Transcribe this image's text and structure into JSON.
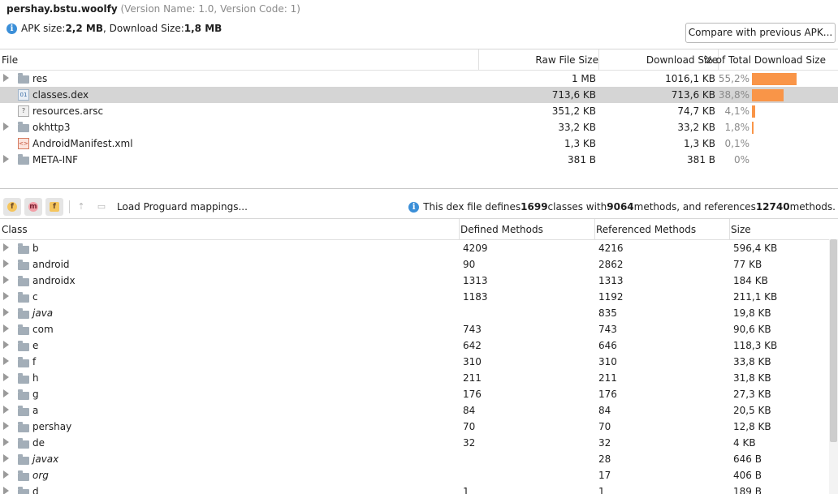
{
  "header": {
    "package": "pershay.bstu.woolfy",
    "version_text": "(Version Name: 1.0, Version Code: 1)",
    "apk_size_label": "APK size: ",
    "apk_size_value": "2,2 MB",
    "download_size_label": ", Download Size: ",
    "download_size_value": "1,8 MB",
    "info_glyph": "i",
    "compare_button": "Compare with previous APK..."
  },
  "file_table": {
    "columns": [
      "File",
      "Raw File Size",
      "Download Size",
      "% of Total Download Size"
    ],
    "rows": [
      {
        "name": "res",
        "icon": "folder-icon",
        "expandable": true,
        "raw": "1 MB",
        "download": "1016,1 KB",
        "pct": "55,2%",
        "pct_value": 55.2,
        "selected": false
      },
      {
        "name": "classes.dex",
        "icon": "dex-file-icon",
        "expandable": false,
        "raw": "713,6 KB",
        "download": "713,6 KB",
        "pct": "38,8%",
        "pct_value": 38.8,
        "selected": true
      },
      {
        "name": "resources.arsc",
        "icon": "arsc-file-icon",
        "expandable": false,
        "raw": "351,2 KB",
        "download": "74,7 KB",
        "pct": "4,1%",
        "pct_value": 4.1,
        "selected": false
      },
      {
        "name": "okhttp3",
        "icon": "folder-icon",
        "expandable": true,
        "raw": "33,2 KB",
        "download": "33,2 KB",
        "pct": "1,8%",
        "pct_value": 1.8,
        "selected": false
      },
      {
        "name": "AndroidManifest.xml",
        "icon": "xml-file-icon",
        "expandable": false,
        "raw": "1,3 KB",
        "download": "1,3 KB",
        "pct": "0,1%",
        "pct_value": 0.1,
        "selected": false
      },
      {
        "name": "META-INF",
        "icon": "folder-icon",
        "expandable": true,
        "raw": "381 B",
        "download": "381 B",
        "pct": "0%",
        "pct_value": 0,
        "selected": false
      }
    ]
  },
  "toolbar": {
    "btn_f": "f",
    "btn_m": "m",
    "btn_rf": "f",
    "proguard_label": "Load Proguard mappings...",
    "dex_info_prefix": "This dex file defines ",
    "classes_count": "1699",
    "dex_info_mid1": " classes with ",
    "methods_count": "9064",
    "dex_info_mid2": " methods, and references ",
    "references_count": "12740",
    "dex_info_suffix": " methods."
  },
  "class_table": {
    "columns": [
      "Class",
      "Defined Methods",
      "Referenced Methods",
      "Size"
    ],
    "rows": [
      {
        "name": "b",
        "italic": false,
        "defined": "4209",
        "referenced": "4216",
        "size": "596,4 KB"
      },
      {
        "name": "android",
        "italic": false,
        "defined": "90",
        "referenced": "2862",
        "size": "77 KB"
      },
      {
        "name": "androidx",
        "italic": false,
        "defined": "1313",
        "referenced": "1313",
        "size": "184 KB"
      },
      {
        "name": "c",
        "italic": false,
        "defined": "1183",
        "referenced": "1192",
        "size": "211,1 KB"
      },
      {
        "name": "java",
        "italic": true,
        "defined": "",
        "referenced": "835",
        "size": "19,8 KB"
      },
      {
        "name": "com",
        "italic": false,
        "defined": "743",
        "referenced": "743",
        "size": "90,6 KB"
      },
      {
        "name": "e",
        "italic": false,
        "defined": "642",
        "referenced": "646",
        "size": "118,3 KB"
      },
      {
        "name": "f",
        "italic": false,
        "defined": "310",
        "referenced": "310",
        "size": "33,8 KB"
      },
      {
        "name": "h",
        "italic": false,
        "defined": "211",
        "referenced": "211",
        "size": "31,8 KB"
      },
      {
        "name": "g",
        "italic": false,
        "defined": "176",
        "referenced": "176",
        "size": "27,3 KB"
      },
      {
        "name": "a",
        "italic": false,
        "defined": "84",
        "referenced": "84",
        "size": "20,5 KB"
      },
      {
        "name": "pershay",
        "italic": false,
        "defined": "70",
        "referenced": "70",
        "size": "12,8 KB"
      },
      {
        "name": "de",
        "italic": false,
        "defined": "32",
        "referenced": "32",
        "size": "4 KB"
      },
      {
        "name": "javax",
        "italic": true,
        "defined": "",
        "referenced": "28",
        "size": "646 B"
      },
      {
        "name": "org",
        "italic": true,
        "defined": "",
        "referenced": "17",
        "size": "406 B"
      },
      {
        "name": "d",
        "italic": false,
        "defined": "1",
        "referenced": "1",
        "size": "189 B"
      }
    ]
  },
  "colors": {
    "bar": "#f99548",
    "selected_row": "#d5d5d5",
    "info_icon": "#3b8fd8"
  }
}
